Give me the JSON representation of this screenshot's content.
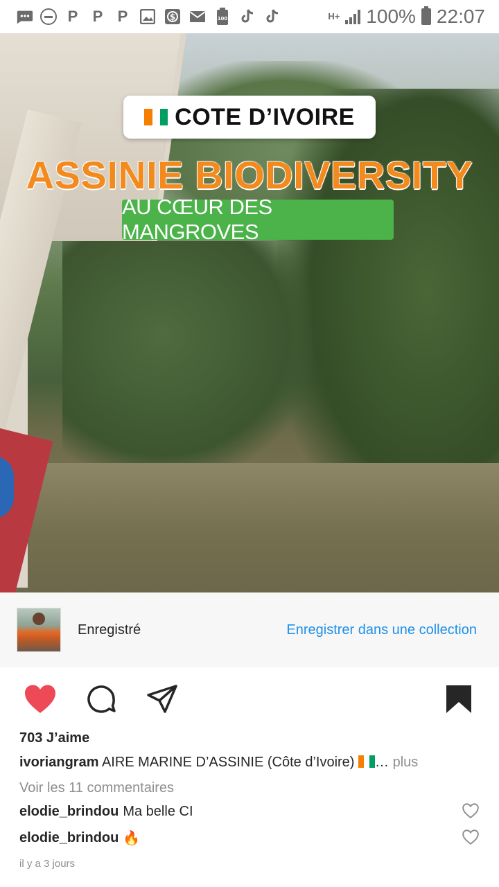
{
  "status_bar": {
    "network_type": "H+",
    "battery_percent": "100%",
    "time": "22:07",
    "left_icons": [
      "message-icon",
      "dnd-icon",
      "p-icon",
      "p-icon",
      "p-icon",
      "gallery-icon",
      "dollar-icon",
      "mail-icon",
      "battery-100-icon",
      "tiktok-icon",
      "tiktok-icon"
    ]
  },
  "post": {
    "media": {
      "flag_label": "COTE D’IVOIRE",
      "headline": "ASSINIE BIODIVERSITY",
      "subtitle": "AU CŒUR DES MANGROVES",
      "flag_colors": [
        "#f77f00",
        "#ffffff",
        "#009e60"
      ]
    },
    "saved_bar": {
      "label": "Enregistré",
      "collection_link": "Enregistrer dans une collection"
    },
    "actions": {
      "liked": true,
      "like_color": "#ed4956",
      "icons": [
        "heart-icon",
        "comment-icon",
        "share-icon",
        "bookmark-icon"
      ]
    },
    "likes_text": "703 J’aime",
    "caption": {
      "username": "ivoriangram",
      "text": " AIRE MARINE D’ASSINIE (Côte d’Ivoire) ",
      "ellipsis": "…",
      "more": " plus"
    },
    "view_comments": "Voir les 11 commentaires",
    "comments": [
      {
        "username": "elodie_brindou",
        "text": "Ma belle CI"
      },
      {
        "username": "elodie_brindou",
        "text": "🔥"
      }
    ],
    "timestamp": "il y a 3 jours"
  },
  "colors": {
    "link_blue": "#1e90e8",
    "headline_orange": "#f28a1e",
    "subtitle_green": "#4cb24a"
  }
}
